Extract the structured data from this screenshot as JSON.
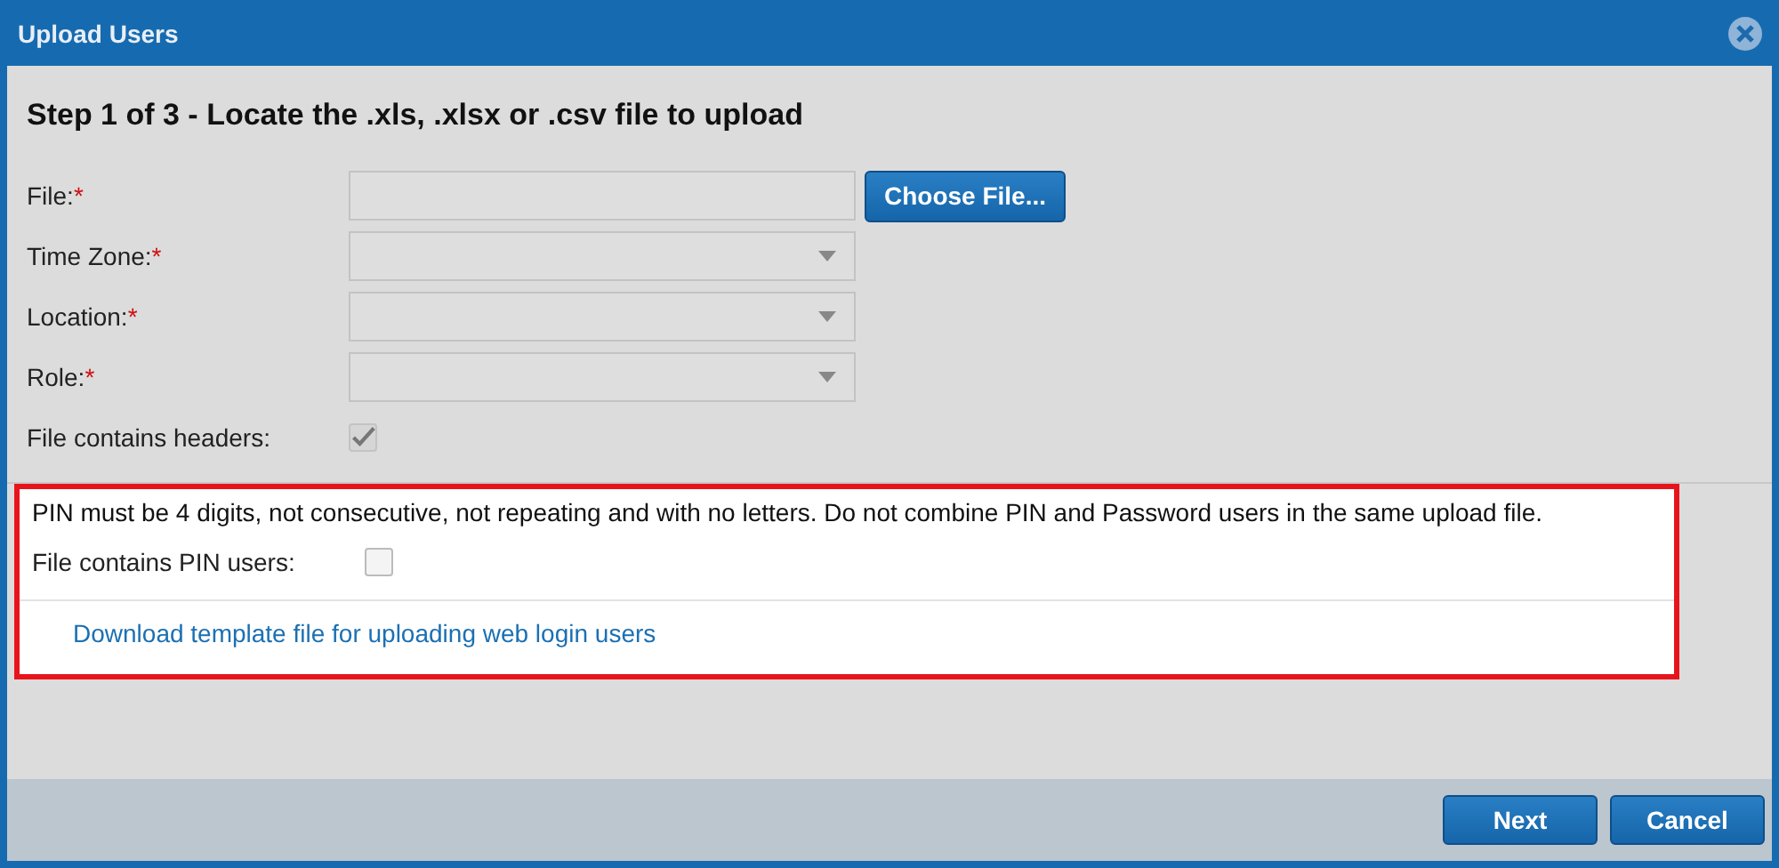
{
  "window": {
    "title": "Upload Users"
  },
  "step_heading": "Step 1 of 3 - Locate the .xls, .xlsx or .csv file to upload",
  "fields": [
    {
      "kind": "file",
      "label": "File:",
      "required_mark": "*",
      "button": "Choose File..."
    },
    {
      "kind": "select",
      "label": "Time Zone:",
      "required_mark": "*"
    },
    {
      "kind": "select",
      "label": "Location:",
      "required_mark": "*"
    },
    {
      "kind": "select",
      "label": "Role:",
      "required_mark": "*"
    }
  ],
  "headers_checkbox": {
    "label": "File contains headers:",
    "checked": true
  },
  "pin_notice": "PIN must be 4 digits, not consecutive, not repeating and with no letters. Do not combine PIN and Password users in the same upload file.",
  "pin_checkbox": {
    "label": "File contains PIN users:",
    "checked": false
  },
  "template_link": "Download template file for uploading web login users",
  "buttons": [
    "Next",
    "Cancel"
  ]
}
